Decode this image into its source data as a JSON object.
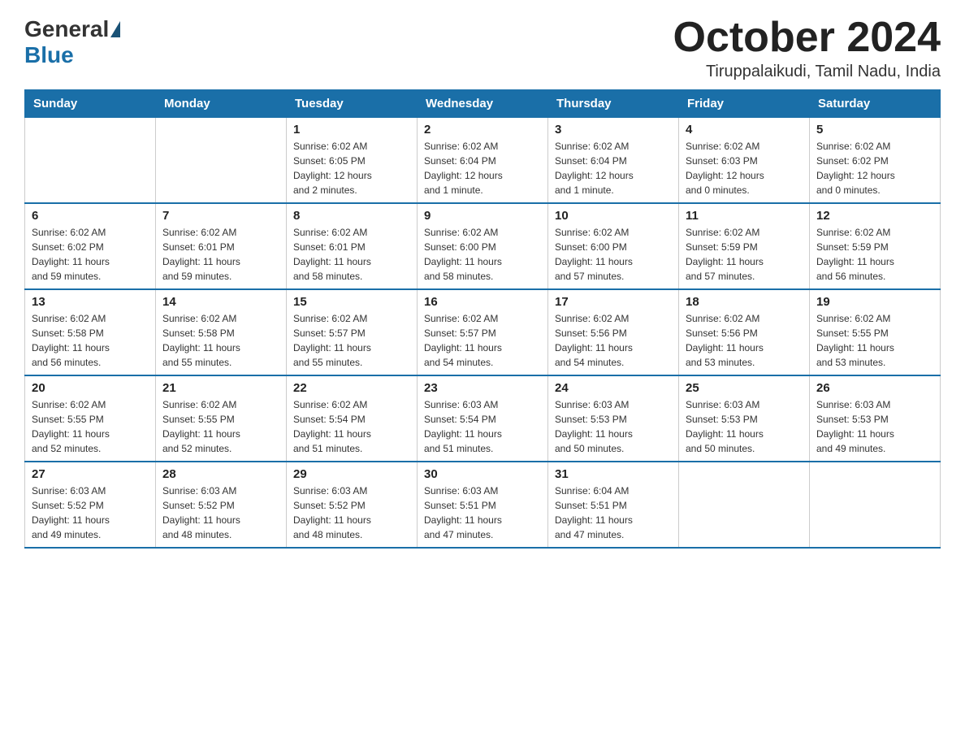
{
  "header": {
    "logo_general": "General",
    "logo_blue": "Blue",
    "month_title": "October 2024",
    "location": "Tiruppalaikudi, Tamil Nadu, India"
  },
  "days_of_week": [
    "Sunday",
    "Monday",
    "Tuesday",
    "Wednesday",
    "Thursday",
    "Friday",
    "Saturday"
  ],
  "weeks": [
    [
      {
        "day": "",
        "info": ""
      },
      {
        "day": "",
        "info": ""
      },
      {
        "day": "1",
        "info": "Sunrise: 6:02 AM\nSunset: 6:05 PM\nDaylight: 12 hours\nand 2 minutes."
      },
      {
        "day": "2",
        "info": "Sunrise: 6:02 AM\nSunset: 6:04 PM\nDaylight: 12 hours\nand 1 minute."
      },
      {
        "day": "3",
        "info": "Sunrise: 6:02 AM\nSunset: 6:04 PM\nDaylight: 12 hours\nand 1 minute."
      },
      {
        "day": "4",
        "info": "Sunrise: 6:02 AM\nSunset: 6:03 PM\nDaylight: 12 hours\nand 0 minutes."
      },
      {
        "day": "5",
        "info": "Sunrise: 6:02 AM\nSunset: 6:02 PM\nDaylight: 12 hours\nand 0 minutes."
      }
    ],
    [
      {
        "day": "6",
        "info": "Sunrise: 6:02 AM\nSunset: 6:02 PM\nDaylight: 11 hours\nand 59 minutes."
      },
      {
        "day": "7",
        "info": "Sunrise: 6:02 AM\nSunset: 6:01 PM\nDaylight: 11 hours\nand 59 minutes."
      },
      {
        "day": "8",
        "info": "Sunrise: 6:02 AM\nSunset: 6:01 PM\nDaylight: 11 hours\nand 58 minutes."
      },
      {
        "day": "9",
        "info": "Sunrise: 6:02 AM\nSunset: 6:00 PM\nDaylight: 11 hours\nand 58 minutes."
      },
      {
        "day": "10",
        "info": "Sunrise: 6:02 AM\nSunset: 6:00 PM\nDaylight: 11 hours\nand 57 minutes."
      },
      {
        "day": "11",
        "info": "Sunrise: 6:02 AM\nSunset: 5:59 PM\nDaylight: 11 hours\nand 57 minutes."
      },
      {
        "day": "12",
        "info": "Sunrise: 6:02 AM\nSunset: 5:59 PM\nDaylight: 11 hours\nand 56 minutes."
      }
    ],
    [
      {
        "day": "13",
        "info": "Sunrise: 6:02 AM\nSunset: 5:58 PM\nDaylight: 11 hours\nand 56 minutes."
      },
      {
        "day": "14",
        "info": "Sunrise: 6:02 AM\nSunset: 5:58 PM\nDaylight: 11 hours\nand 55 minutes."
      },
      {
        "day": "15",
        "info": "Sunrise: 6:02 AM\nSunset: 5:57 PM\nDaylight: 11 hours\nand 55 minutes."
      },
      {
        "day": "16",
        "info": "Sunrise: 6:02 AM\nSunset: 5:57 PM\nDaylight: 11 hours\nand 54 minutes."
      },
      {
        "day": "17",
        "info": "Sunrise: 6:02 AM\nSunset: 5:56 PM\nDaylight: 11 hours\nand 54 minutes."
      },
      {
        "day": "18",
        "info": "Sunrise: 6:02 AM\nSunset: 5:56 PM\nDaylight: 11 hours\nand 53 minutes."
      },
      {
        "day": "19",
        "info": "Sunrise: 6:02 AM\nSunset: 5:55 PM\nDaylight: 11 hours\nand 53 minutes."
      }
    ],
    [
      {
        "day": "20",
        "info": "Sunrise: 6:02 AM\nSunset: 5:55 PM\nDaylight: 11 hours\nand 52 minutes."
      },
      {
        "day": "21",
        "info": "Sunrise: 6:02 AM\nSunset: 5:55 PM\nDaylight: 11 hours\nand 52 minutes."
      },
      {
        "day": "22",
        "info": "Sunrise: 6:02 AM\nSunset: 5:54 PM\nDaylight: 11 hours\nand 51 minutes."
      },
      {
        "day": "23",
        "info": "Sunrise: 6:03 AM\nSunset: 5:54 PM\nDaylight: 11 hours\nand 51 minutes."
      },
      {
        "day": "24",
        "info": "Sunrise: 6:03 AM\nSunset: 5:53 PM\nDaylight: 11 hours\nand 50 minutes."
      },
      {
        "day": "25",
        "info": "Sunrise: 6:03 AM\nSunset: 5:53 PM\nDaylight: 11 hours\nand 50 minutes."
      },
      {
        "day": "26",
        "info": "Sunrise: 6:03 AM\nSunset: 5:53 PM\nDaylight: 11 hours\nand 49 minutes."
      }
    ],
    [
      {
        "day": "27",
        "info": "Sunrise: 6:03 AM\nSunset: 5:52 PM\nDaylight: 11 hours\nand 49 minutes."
      },
      {
        "day": "28",
        "info": "Sunrise: 6:03 AM\nSunset: 5:52 PM\nDaylight: 11 hours\nand 48 minutes."
      },
      {
        "day": "29",
        "info": "Sunrise: 6:03 AM\nSunset: 5:52 PM\nDaylight: 11 hours\nand 48 minutes."
      },
      {
        "day": "30",
        "info": "Sunrise: 6:03 AM\nSunset: 5:51 PM\nDaylight: 11 hours\nand 47 minutes."
      },
      {
        "day": "31",
        "info": "Sunrise: 6:04 AM\nSunset: 5:51 PM\nDaylight: 11 hours\nand 47 minutes."
      },
      {
        "day": "",
        "info": ""
      },
      {
        "day": "",
        "info": ""
      }
    ]
  ]
}
